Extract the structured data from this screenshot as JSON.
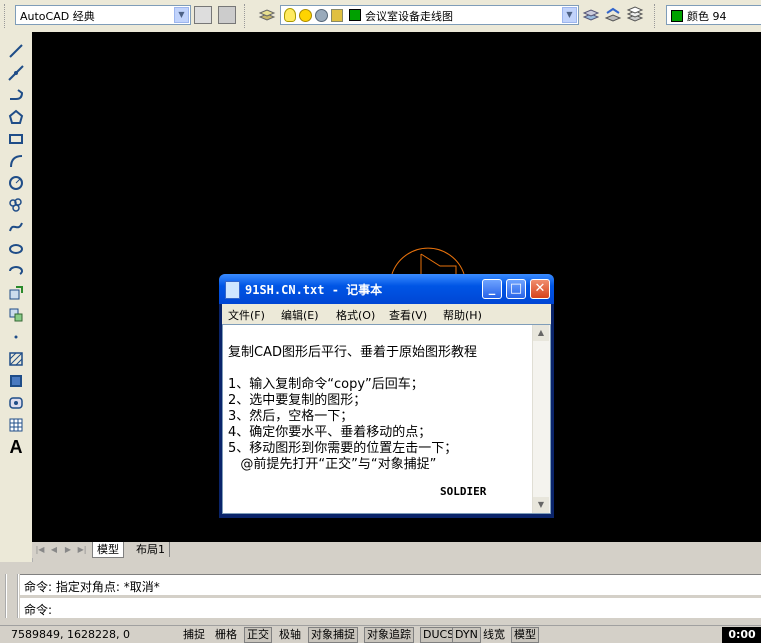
{
  "toolbar": {
    "workspace": "AutoCAD 经典",
    "layer_name": "会议室设备走线图",
    "color_label": "颜色 94",
    "color_swatch": "#00a000",
    "layer_swatch": "#00a000"
  },
  "notepad": {
    "title": "91SH.CN.txt - 记事本",
    "menu": [
      "文件(F)",
      "编辑(E)",
      "格式(O)",
      "查看(V)",
      "帮助(H)"
    ],
    "lines": [
      "复制CAD图形后平行、垂着于原始图形教程",
      "",
      "1、输入复制命令“copy”后回车；",
      "2、选中要复制的图形；",
      "3、然后，空格一下；",
      "4、确定你要水平、垂着移动的点；",
      "5、移动图形到你需要的位置左击一下；",
      "   @前提先打开“正交”与“对象捕捉”",
      "",
      "SOLDIER"
    ]
  },
  "tabs": {
    "model": "模型",
    "layout1": "布局1"
  },
  "command": {
    "history": "命令: 指定对角点: *取消*",
    "prompt": "命令:"
  },
  "status": {
    "coords": "7589849, 1628228, 0",
    "toggles": [
      "捕捉",
      "栅格",
      "正交",
      "极轴",
      "对象捕捉",
      "对象追踪",
      "DUCS",
      "DYN",
      "线宽",
      "模型"
    ],
    "clock": "0:00"
  },
  "colors": {
    "canvas": "#000000",
    "drawing_stroke": "#e8720c",
    "title_bar": "#0055e5"
  }
}
